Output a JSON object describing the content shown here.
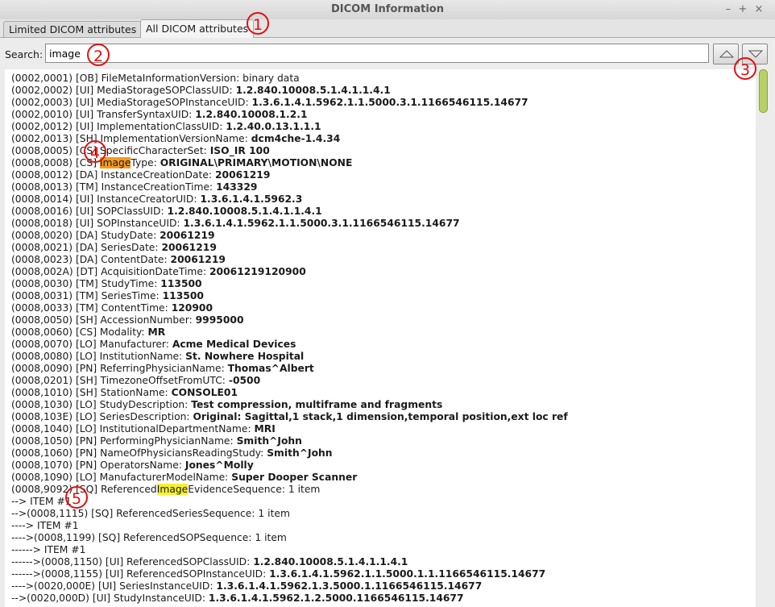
{
  "window": {
    "title": "DICOM Information",
    "controls": [
      "–",
      "+",
      "×"
    ]
  },
  "tabs": [
    {
      "label": "Limited DICOM attributes"
    },
    {
      "label": "All DICOM attributes"
    }
  ],
  "search": {
    "label": "Search:",
    "value": "image"
  },
  "nav_buttons": {
    "up_icon": "triangle-up-icon",
    "down_icon": "triangle-down-icon"
  },
  "markers": [
    "1",
    "2",
    "3",
    "4",
    "5"
  ],
  "lines": [
    {
      "pre": "(0002,0001) [OB] FileMetaInformationVersion: binary data",
      "hl": "",
      "post": "",
      "v": ""
    },
    {
      "pre": "(0002,0002) [UI] MediaStorageSOPClassUID: ",
      "hl": "",
      "post": "",
      "v": "1.2.840.10008.5.1.4.1.1.4.1"
    },
    {
      "pre": "(0002,0003) [UI] MediaStorageSOPInstanceUID: ",
      "hl": "",
      "post": "",
      "v": "1.3.6.1.4.1.5962.1.1.5000.3.1.1166546115.14677"
    },
    {
      "pre": "(0002,0010) [UI] TransferSyntaxUID: ",
      "hl": "",
      "post": "",
      "v": "1.2.840.10008.1.2.1"
    },
    {
      "pre": "(0002,0012) [UI] ImplementationClassUID: ",
      "hl": "",
      "post": "",
      "v": "1.2.40.0.13.1.1.1"
    },
    {
      "pre": "(0002,0013) [SH] ImplementationVersionName: ",
      "hl": "",
      "post": "",
      "v": "dcm4che-1.4.34"
    },
    {
      "pre": "(0008,0005) [CS] SpecificCharacterSet: ",
      "hl": "",
      "post": "",
      "v": "ISO_IR 100"
    },
    {
      "pre": "(0008,0008) [CS] ",
      "hl": "Image",
      "post": "Type: ",
      "v": "ORIGINAL\\PRIMARY\\MOTION\\NONE",
      "current": true
    },
    {
      "pre": "(0008,0012) [DA] InstanceCreationDate: ",
      "hl": "",
      "post": "",
      "v": "20061219"
    },
    {
      "pre": "(0008,0013) [TM] InstanceCreationTime: ",
      "hl": "",
      "post": "",
      "v": "143329"
    },
    {
      "pre": "(0008,0014) [UI] InstanceCreatorUID: ",
      "hl": "",
      "post": "",
      "v": "1.3.6.1.4.1.5962.3"
    },
    {
      "pre": "(0008,0016) [UI] SOPClassUID: ",
      "hl": "",
      "post": "",
      "v": "1.2.840.10008.5.1.4.1.1.4.1"
    },
    {
      "pre": "(0008,0018) [UI] SOPInstanceUID: ",
      "hl": "",
      "post": "",
      "v": "1.3.6.1.4.1.5962.1.1.5000.3.1.1166546115.14677"
    },
    {
      "pre": "(0008,0020) [DA] StudyDate: ",
      "hl": "",
      "post": "",
      "v": "20061219"
    },
    {
      "pre": "(0008,0021) [DA] SeriesDate: ",
      "hl": "",
      "post": "",
      "v": "20061219"
    },
    {
      "pre": "(0008,0023) [DA] ContentDate: ",
      "hl": "",
      "post": "",
      "v": "20061219"
    },
    {
      "pre": "(0008,002A) [DT] AcquisitionDateTime: ",
      "hl": "",
      "post": "",
      "v": "20061219120900"
    },
    {
      "pre": "(0008,0030) [TM] StudyTime: ",
      "hl": "",
      "post": "",
      "v": "113500"
    },
    {
      "pre": "(0008,0031) [TM] SeriesTime: ",
      "hl": "",
      "post": "",
      "v": "113500"
    },
    {
      "pre": "(0008,0033) [TM] ContentTime: ",
      "hl": "",
      "post": "",
      "v": "120900"
    },
    {
      "pre": "(0008,0050) [SH] AccessionNumber: ",
      "hl": "",
      "post": "",
      "v": "9995000"
    },
    {
      "pre": "(0008,0060) [CS] Modality: ",
      "hl": "",
      "post": "",
      "v": "MR"
    },
    {
      "pre": "(0008,0070) [LO] Manufacturer: ",
      "hl": "",
      "post": "",
      "v": "Acme Medical Devices"
    },
    {
      "pre": "(0008,0080) [LO] InstitutionName: ",
      "hl": "",
      "post": "",
      "v": "St. Nowhere Hospital"
    },
    {
      "pre": "(0008,0090) [PN] ReferringPhysicianName: ",
      "hl": "",
      "post": "",
      "v": "Thomas^Albert"
    },
    {
      "pre": "(0008,0201) [SH] TimezoneOffsetFromUTC: ",
      "hl": "",
      "post": "",
      "v": "-0500"
    },
    {
      "pre": "(0008,1010) [SH] StationName: ",
      "hl": "",
      "post": "",
      "v": "CONSOLE01"
    },
    {
      "pre": "(0008,1030) [LO] StudyDescription: ",
      "hl": "",
      "post": "",
      "v": "Test compression, multiframe and fragments"
    },
    {
      "pre": "(0008,103E) [LO] SeriesDescription: ",
      "hl": "",
      "post": "",
      "v": "Original: Sagittal,1 stack,1 dimension,temporal position,ext loc ref"
    },
    {
      "pre": "(0008,1040) [LO] InstitutionalDepartmentName: ",
      "hl": "",
      "post": "",
      "v": "MRI"
    },
    {
      "pre": "(0008,1050) [PN] PerformingPhysicianName: ",
      "hl": "",
      "post": "",
      "v": "Smith^John"
    },
    {
      "pre": "(0008,1060) [PN] NameOfPhysiciansReadingStudy: ",
      "hl": "",
      "post": "",
      "v": "Smith^John"
    },
    {
      "pre": "(0008,1070) [PN] OperatorsName: ",
      "hl": "",
      "post": "",
      "v": "Jones^Molly"
    },
    {
      "pre": "(0008,1090) [LO] ManufacturerModelName: ",
      "hl": "",
      "post": "",
      "v": "Super Dooper Scanner"
    },
    {
      "pre": "(0008,9092) [SQ] Referenced",
      "hl": "Image",
      "post": "EvidenceSequence: 1 item",
      "v": ""
    },
    {
      "pre": "--> ITEM #1",
      "hl": "",
      "post": "",
      "v": ""
    },
    {
      "pre": "-->(0008,1115) [SQ] ReferencedSeriesSequence: 1 item",
      "hl": "",
      "post": "",
      "v": ""
    },
    {
      "pre": "----> ITEM #1",
      "hl": "",
      "post": "",
      "v": ""
    },
    {
      "pre": "---->(0008,1199) [SQ] ReferencedSOPSequence: 1 item",
      "hl": "",
      "post": "",
      "v": ""
    },
    {
      "pre": "------> ITEM #1",
      "hl": "",
      "post": "",
      "v": ""
    },
    {
      "pre": "------>(0008,1150) [UI] ReferencedSOPClassUID: ",
      "hl": "",
      "post": "",
      "v": "1.2.840.10008.5.1.4.1.1.4.1"
    },
    {
      "pre": "------>(0008,1155) [UI] ReferencedSOPInstanceUID: ",
      "hl": "",
      "post": "",
      "v": "1.3.6.1.4.1.5962.1.1.5000.1.1.1166546115.14677"
    },
    {
      "pre": "---->(0020,000E) [UI] SeriesInstanceUID: ",
      "hl": "",
      "post": "",
      "v": "1.3.6.1.4.1.5962.1.3.5000.1.1166546115.14677"
    },
    {
      "pre": "-->(0020,000D) [UI] StudyInstanceUID: ",
      "hl": "",
      "post": "",
      "v": "1.3.6.1.4.1.5962.1.2.5000.1166546115.14677"
    }
  ]
}
